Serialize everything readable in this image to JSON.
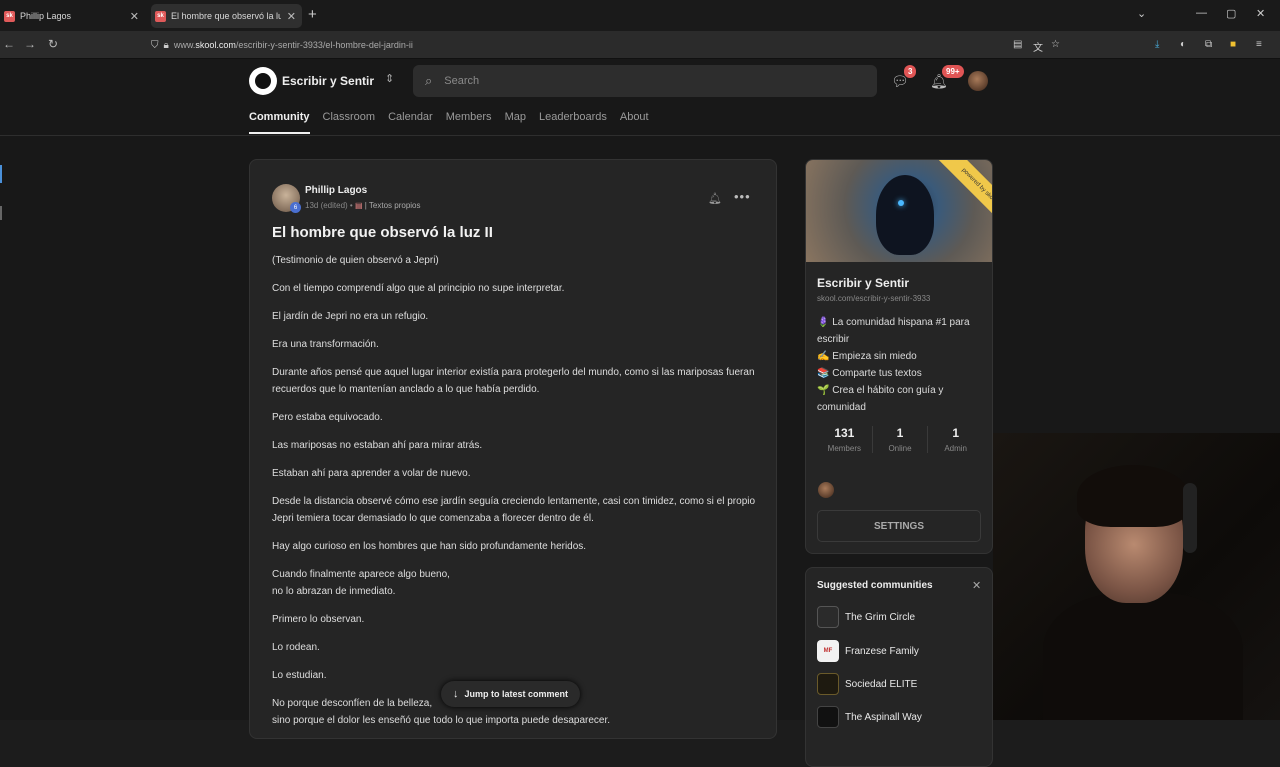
{
  "browser": {
    "tabs": [
      {
        "label": "Phillip Lagos",
        "favicon": "sk"
      },
      {
        "label": "El hombre que observó la luz II",
        "favicon": "sk"
      }
    ],
    "url_prefix": "www.",
    "url_domain": "skool.com",
    "url_path": "/escribir-y-sentir-3933/el-hombre-del-jardin-ii"
  },
  "header": {
    "community_name": "Escribir y Sentir",
    "search_placeholder": "Search",
    "chat_badge": "3",
    "notif_badge": "99+"
  },
  "nav": {
    "tabs": [
      "Community",
      "Classroom",
      "Calendar",
      "Members",
      "Map",
      "Leaderboards",
      "About"
    ],
    "active": "Community"
  },
  "post": {
    "author": "Phillip Lagos",
    "level": "6",
    "meta": "13d (edited) •",
    "category": "| Textos propios",
    "title": "El hombre que observó la luz II",
    "paragraphs": [
      "(Testimonio de quien observó a Jepri)",
      "Con el tiempo comprendí algo que al principio no supe interpretar.",
      "El jardín de Jepri no era un refugio.",
      "Era una transformación.",
      "Durante años pensé que aquel lugar interior existía para protegerlo del mundo, como si las mariposas fueran recuerdos que lo mantenían anclado a lo que había perdido.",
      "Pero estaba equivocado.",
      "Las mariposas no estaban ahí para mirar atrás.",
      "Estaban ahí para aprender a volar de nuevo.",
      "Desde la distancia observé cómo ese jardín seguía creciendo lentamente, casi con timidez, como si el propio Jepri temiera tocar demasiado lo que comenzaba a florecer dentro de él.",
      "Hay algo curioso en los hombres que han sido profundamente heridos.",
      "Cuando finalmente aparece algo bueno,",
      "no lo abrazan de inmediato.",
      "Primero lo observan.",
      "Lo rodean.",
      "Lo estudian.",
      "No porque desconfíen de la belleza,",
      "sino porque el dolor les enseñó que todo lo que importa puede desaparecer."
    ],
    "jump_label": "Jump to latest comment"
  },
  "sidebar": {
    "ribbon": "powered by skool",
    "name": "Escribir y Sentir",
    "url": "skool.com/escribir-y-sentir-3933",
    "desc": [
      "🪻 La comunidad hispana #1 para escribir",
      "✍️ Empieza sin miedo",
      "📚 Comparte tus textos",
      "🌱 Crea el hábito con guía y comunidad"
    ],
    "stats": [
      {
        "n": "131",
        "l": "Members"
      },
      {
        "n": "1",
        "l": "Online"
      },
      {
        "n": "1",
        "l": "Admin"
      }
    ],
    "settings_label": "SETTINGS"
  },
  "suggested": {
    "title": "Suggested communities",
    "items": [
      {
        "name": "The Grim Circle",
        "color": "#2b2b2b",
        "abbr": ""
      },
      {
        "name": "Franzese Family",
        "color": "#f2f2f2",
        "abbr": "MF"
      },
      {
        "name": "Sociedad ELITE",
        "color": "#1e1a10",
        "abbr": ""
      },
      {
        "name": "The Aspinall Way",
        "color": "#111111",
        "abbr": ""
      }
    ]
  }
}
